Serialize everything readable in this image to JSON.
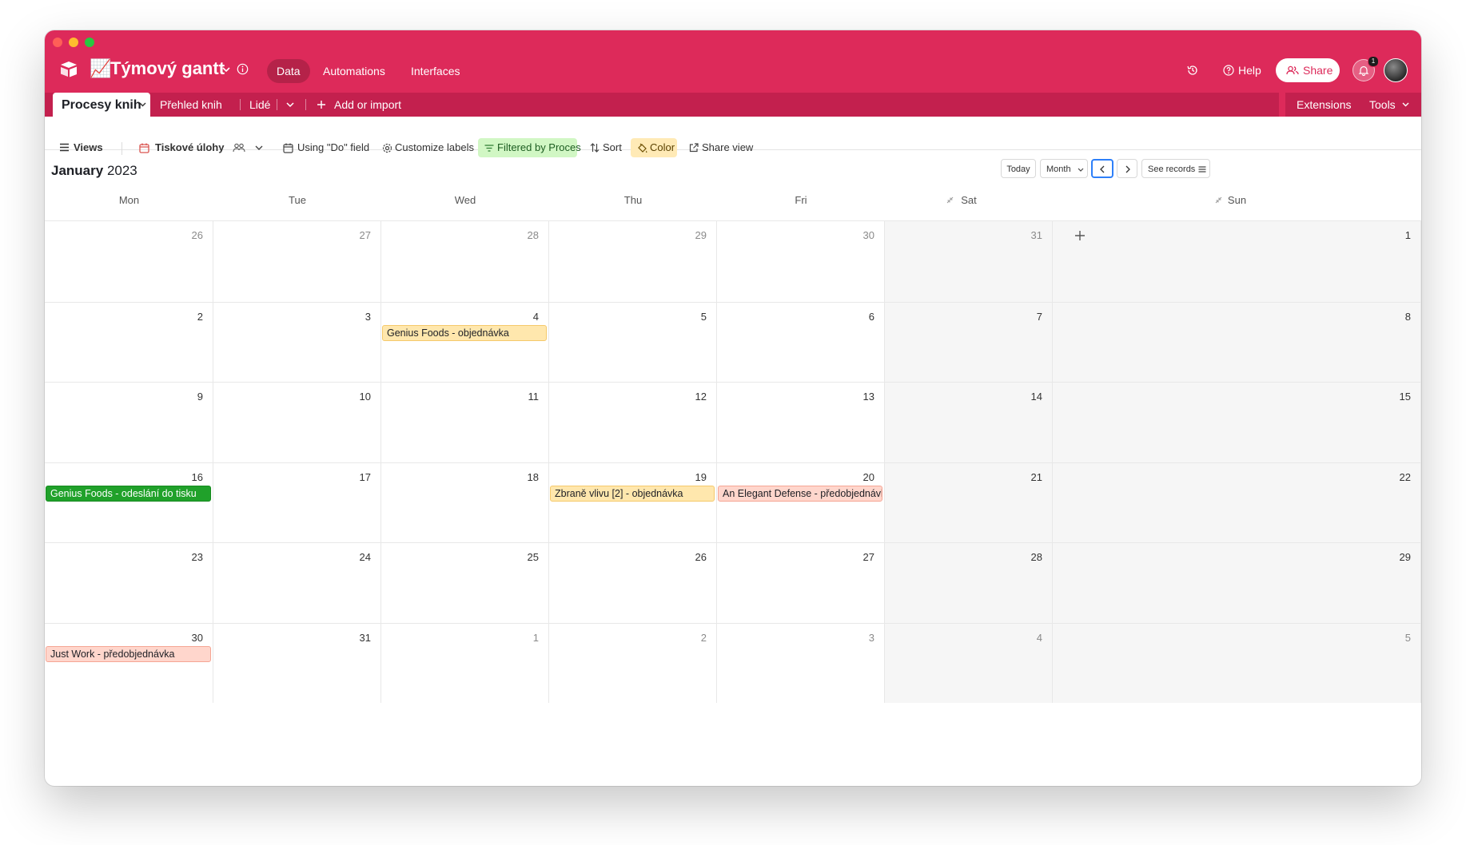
{
  "app": {
    "base_icon": "📈",
    "base_name": "Týmový gantt",
    "nav": [
      "Data",
      "Automations",
      "Interfaces"
    ],
    "help": "Help",
    "share": "Share",
    "notification_count": "1"
  },
  "tabs": {
    "active": "Procesy knih",
    "items": [
      "Přehled knih",
      "Lidé"
    ],
    "add": "Add or import",
    "extensions": "Extensions",
    "tools": "Tools"
  },
  "toolbar": {
    "views": "Views",
    "view_name": "Tiskové úlohy",
    "date_field": "Using \"Do\" field",
    "labels": "Customize labels",
    "filter": "Filtered by Proces",
    "sort": "Sort",
    "color": "Color",
    "share_view": "Share view"
  },
  "calendar": {
    "month": "January",
    "year": "2023",
    "today": "Today",
    "mode": "Month",
    "see_records": "See records",
    "weekdays": [
      "Mon",
      "Tue",
      "Wed",
      "Thu",
      "Fri",
      "Sat",
      "Sun"
    ],
    "weeks": [
      [
        "26",
        "27",
        "28",
        "29",
        "30",
        "31",
        "1"
      ],
      [
        "2",
        "3",
        "4",
        "5",
        "6",
        "7",
        "8"
      ],
      [
        "9",
        "10",
        "11",
        "12",
        "13",
        "14",
        "15"
      ],
      [
        "16",
        "17",
        "18",
        "19",
        "20",
        "21",
        "22"
      ],
      [
        "23",
        "24",
        "25",
        "26",
        "27",
        "28",
        "29"
      ],
      [
        "30",
        "31",
        "1",
        "2",
        "3",
        "4",
        "5"
      ]
    ],
    "outside_month": [
      [
        true,
        true,
        true,
        true,
        true,
        true,
        false
      ],
      [],
      [],
      [],
      [],
      [
        false,
        false,
        true,
        true,
        true,
        true,
        true
      ]
    ],
    "events": [
      {
        "title": "Genius Foods - objednávka",
        "date": "2023-01-04",
        "color": "#ffe7ad"
      },
      {
        "title": "Genius Foods - odeslání do tisku",
        "date": "2023-01-16",
        "color": "#20a12a"
      },
      {
        "title": "Zbraně vlivu [2] - objednávka",
        "date": "2023-01-19",
        "color": "#ffe7ad"
      },
      {
        "title": "An Elegant Defense - předobjednávka",
        "date": "2023-01-20",
        "color": "#ffd6cc"
      },
      {
        "title": "Just Work - předobjednávka",
        "date": "2023-01-30",
        "color": "#ffd6cc"
      }
    ]
  },
  "colors": {
    "brand": "#dd2a5a",
    "filter_bg": "#d1f7c4",
    "color_bg": "#ffeab6"
  }
}
